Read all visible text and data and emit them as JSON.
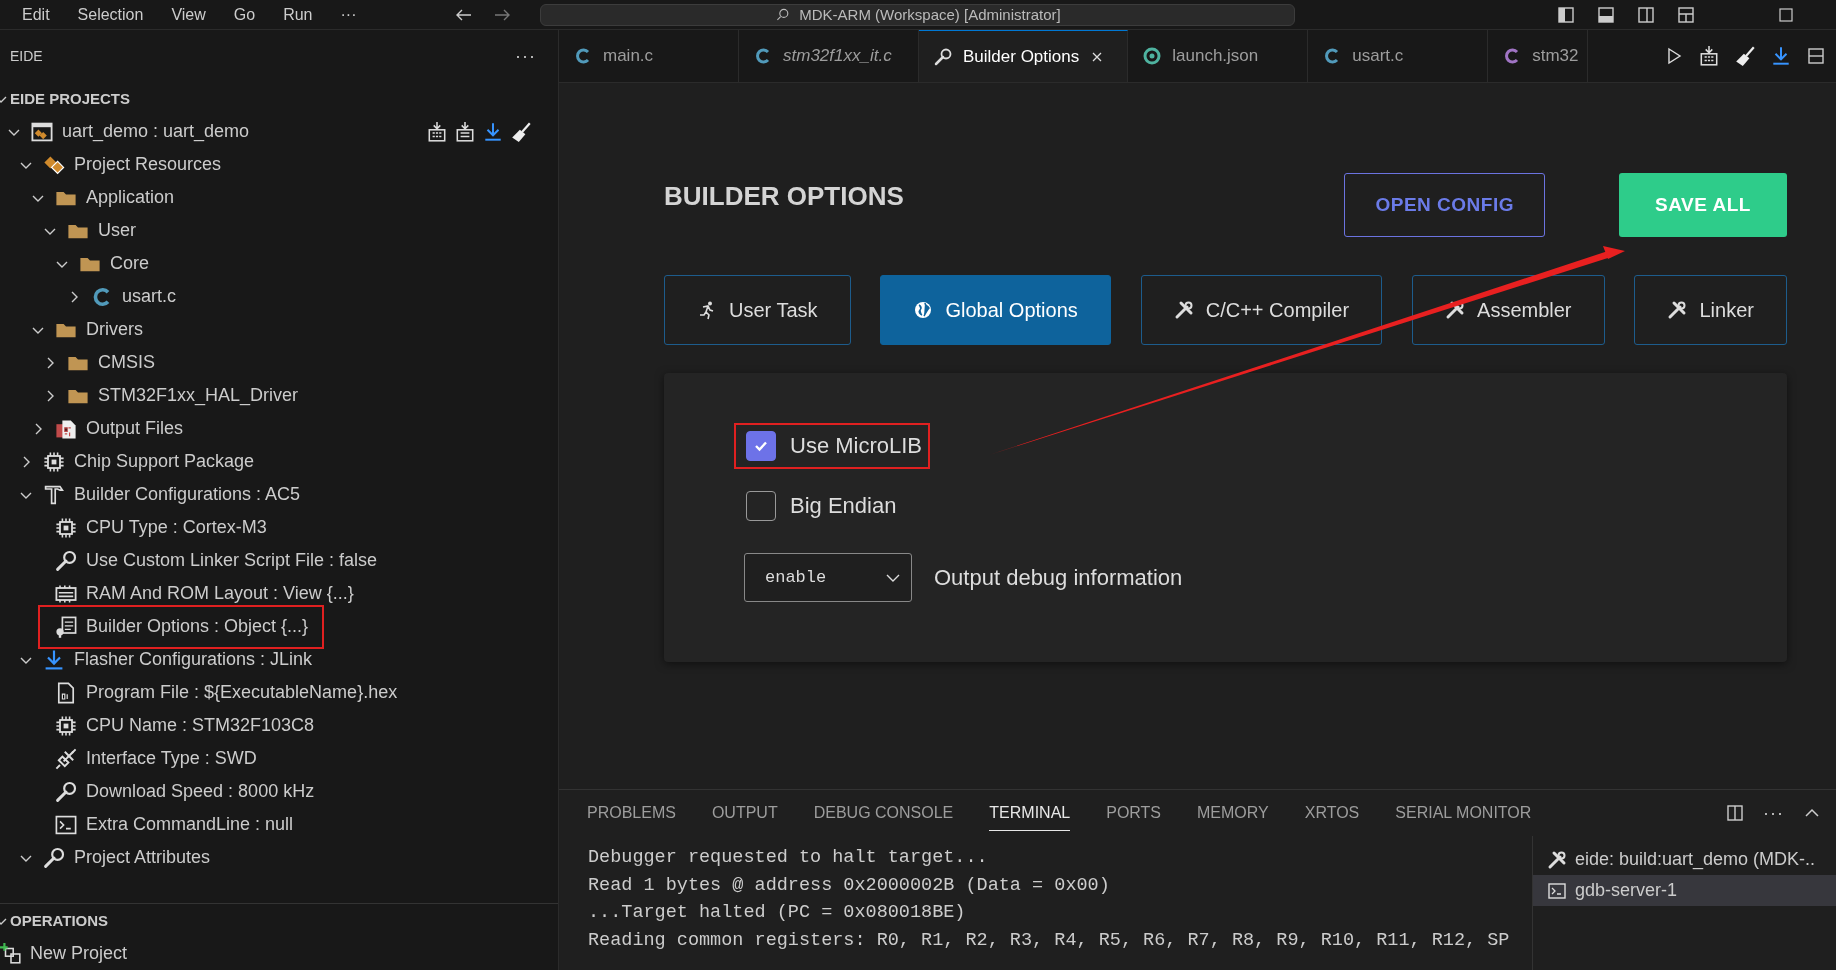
{
  "menu": [
    "Edit",
    "Selection",
    "View",
    "Go",
    "Run",
    "···"
  ],
  "command_center": "MDK-ARM (Workspace) [Administrator]",
  "sidebar": {
    "title": "EIDE",
    "more": "···",
    "projects": {
      "title": "EIDE PROJECTS",
      "expanded": true,
      "tree": [
        {
          "label": "uart_demo : uart_demo",
          "kind": "project",
          "expanded": true,
          "children": [
            {
              "label": "Project Resources",
              "kind": "resources",
              "expanded": true,
              "children": [
                {
                  "label": "Application",
                  "kind": "folder",
                  "expanded": true,
                  "children": [
                    {
                      "label": "User",
                      "kind": "folder",
                      "expanded": true,
                      "children": [
                        {
                          "label": "Core",
                          "kind": "folder",
                          "expanded": true,
                          "children": [
                            {
                              "label": "usart.c",
                              "kind": "c",
                              "expanded": false
                            }
                          ]
                        }
                      ]
                    }
                  ]
                },
                {
                  "label": "Drivers",
                  "kind": "folder",
                  "expanded": true,
                  "children": [
                    {
                      "label": "CMSIS",
                      "kind": "folder",
                      "expanded": false
                    },
                    {
                      "label": "STM32F1xx_HAL_Driver",
                      "kind": "folder",
                      "expanded": false
                    }
                  ]
                },
                {
                  "label": "Output Files",
                  "kind": "output",
                  "expanded": false
                }
              ]
            },
            {
              "label": "Chip Support Package",
              "kind": "chip",
              "expanded": false
            },
            {
              "label": "Builder Configurations : AC5",
              "kind": "hammer",
              "expanded": true,
              "children": [
                {
                  "label": "CPU Type : Cortex-M3",
                  "kind": "chip"
                },
                {
                  "label": "Use Custom Linker Script File : false",
                  "kind": "wrench"
                },
                {
                  "label": "RAM And ROM Layout : View {...}",
                  "kind": "memory"
                },
                {
                  "label": "Builder Options : Object {...}",
                  "kind": "options",
                  "annotated": true
                }
              ]
            },
            {
              "label": "Flasher Configurations : JLink",
              "kind": "download",
              "expanded": true,
              "children": [
                {
                  "label": "Program File : ${ExecutableName}.hex",
                  "kind": "file"
                },
                {
                  "label": "CPU Name : STM32F103C8",
                  "kind": "chip"
                },
                {
                  "label": "Interface Type : SWD",
                  "kind": "plug"
                },
                {
                  "label": "Download Speed : 8000 kHz",
                  "kind": "wrench"
                },
                {
                  "label": "Extra CommandLine : null",
                  "kind": "terminal"
                }
              ]
            },
            {
              "label": "Project Attributes",
              "kind": "wrench",
              "expanded": true
            }
          ]
        }
      ]
    },
    "operations": {
      "title": "OPERATIONS",
      "expanded": true,
      "items": [
        {
          "label": "New Project",
          "kind": "new-project"
        }
      ]
    }
  },
  "editor_tabs": [
    {
      "label": "main.c",
      "kind": "c",
      "preview": false,
      "selected": false
    },
    {
      "label": "stm32f1xx_it.c",
      "kind": "c",
      "preview": true,
      "selected": false
    },
    {
      "label": "Builder Options",
      "kind": "wrench",
      "preview": false,
      "selected": true
    },
    {
      "label": "launch.json",
      "kind": "json",
      "preview": false,
      "selected": false
    },
    {
      "label": "usart.c",
      "kind": "c",
      "preview": false,
      "selected": false
    },
    {
      "label": "stm32",
      "kind": "h",
      "preview": false,
      "selected": false
    }
  ],
  "builder": {
    "title": "BUILDER OPTIONS",
    "buttons": [
      {
        "label": "OPEN CONFIG",
        "kind": "outline"
      },
      {
        "label": "SAVE ALL",
        "kind": "primary"
      }
    ],
    "tabs": [
      {
        "label": "User Task",
        "kind": "runner",
        "selected": false
      },
      {
        "label": "Global Options",
        "kind": "globe",
        "selected": true
      },
      {
        "label": "C/C++ Compiler",
        "kind": "tools",
        "selected": false
      },
      {
        "label": "Assembler",
        "kind": "tools",
        "selected": false
      },
      {
        "label": "Linker",
        "kind": "tools",
        "selected": false
      }
    ],
    "options": [
      {
        "kind": "checkbox",
        "label": "Use MicroLIB",
        "checked": true,
        "annotated": true
      },
      {
        "kind": "checkbox",
        "label": "Big Endian",
        "checked": false,
        "annotated": false
      },
      {
        "kind": "select",
        "value": "enable",
        "label": "Output debug information"
      }
    ]
  },
  "annotation_arrow": true,
  "panel": {
    "tabs": [
      {
        "label": "PROBLEMS",
        "selected": false
      },
      {
        "label": "OUTPUT",
        "selected": false
      },
      {
        "label": "DEBUG CONSOLE",
        "selected": false
      },
      {
        "label": "TERMINAL",
        "selected": true
      },
      {
        "label": "PORTS",
        "selected": false
      },
      {
        "label": "MEMORY",
        "selected": false
      },
      {
        "label": "XRTOS",
        "selected": false
      },
      {
        "label": "SERIAL MONITOR",
        "selected": false
      }
    ],
    "more": "···",
    "terminal_lines": [
      "Debugger requested to halt target...",
      "Read 1 bytes @ address 0x2000002B (Data = 0x00)",
      "...Target halted (PC = 0x080018BE)",
      "Reading common registers: R0, R1, R2, R3, R4, R5, R6, R7, R8, R9, R10, R11, R12, SP"
    ],
    "terminals": [
      {
        "label": "eide: build:uart_demo (MDK-..",
        "kind": "tools",
        "selected": false
      },
      {
        "label": "gdb-server-1",
        "kind": "terminal",
        "selected": true
      }
    ]
  }
}
